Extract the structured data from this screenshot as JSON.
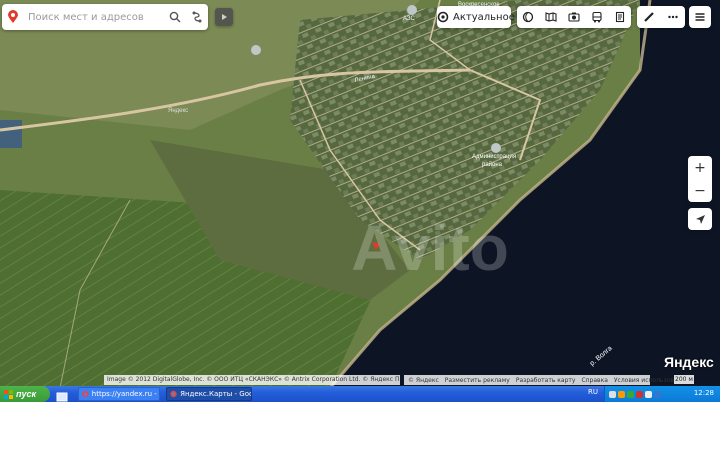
{
  "search": {
    "placeholder": "Поиск мест и адресов"
  },
  "map": {
    "labels": {
      "gas_station": "АЗС",
      "street_top": "Воскресенское",
      "road": "Яндекс",
      "street_center": "Ленина",
      "administration": "Администрация",
      "administration_2": "района",
      "river": "р. Волга"
    },
    "watermark": "Avito"
  },
  "toolbar": {
    "actual_label": "Актуальное",
    "layers": [
      "globe-icon",
      "panorama-icon",
      "camera-icon",
      "bus-icon",
      "doc-icon"
    ],
    "tools": [
      "ruler-icon",
      "more-icon"
    ]
  },
  "zoom": {
    "in": "+",
    "out": "−"
  },
  "brand": {
    "logo": "Яндекс"
  },
  "footer": {
    "copyright": "Image © 2012 DigitalGlobe, Inc. © ООО ИТЦ «СКАНЭКС» © Antrix Corporation Ltd. © Яндекс  Правообладатель",
    "links": [
      "© Яндекс",
      "Разместить рекламу",
      "Разработать карту",
      "Справка",
      "Условия использования"
    ],
    "scale": "200 м"
  },
  "taskbar": {
    "start_label": "пуск",
    "tasks": [
      {
        "label": "https://yandex.ru - G..."
      },
      {
        "label": "Яндекс.Карты - Goo..."
      }
    ],
    "language": "RU",
    "clock": "12:28"
  },
  "colors": {
    "water": "#0d1525",
    "field": "#5c7a3c",
    "road": "#d8c6a2",
    "marker": "#e23b2e",
    "taskbar": "#245edb",
    "start": "#3a9a37"
  }
}
